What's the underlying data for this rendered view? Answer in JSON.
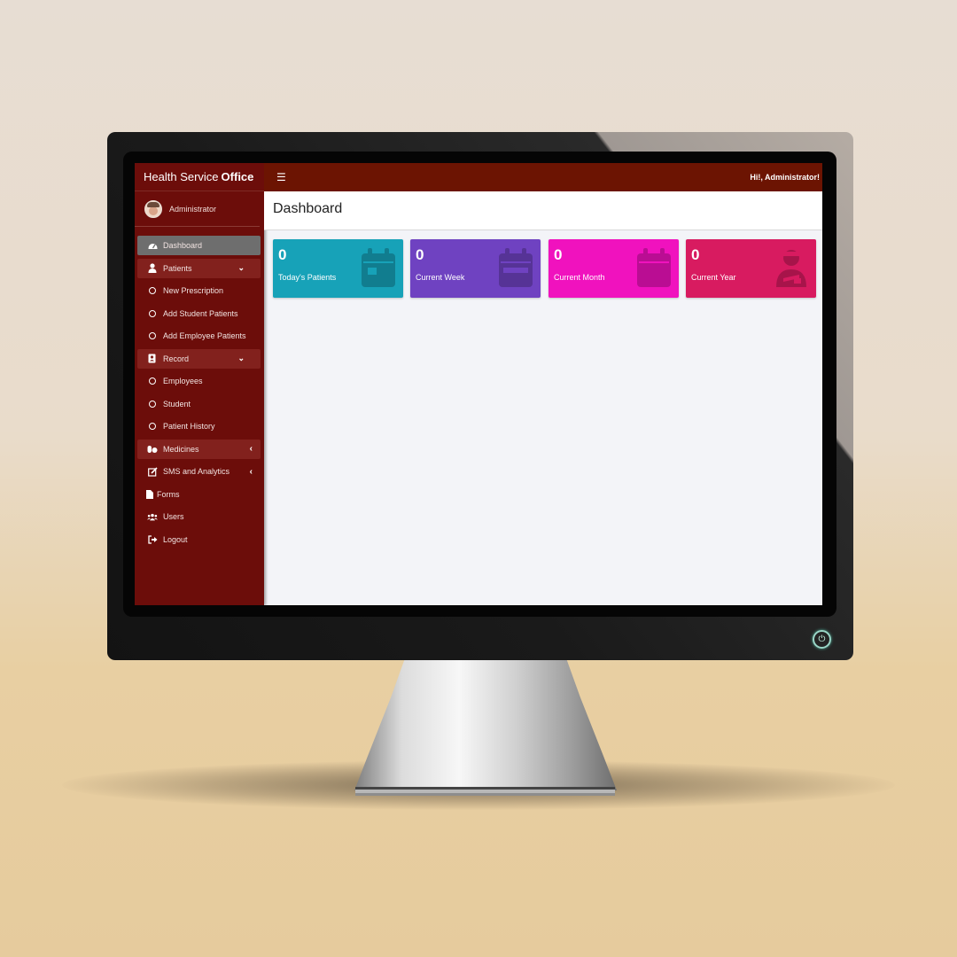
{
  "app": {
    "brand_light": "Health Service",
    "brand_bold": "Office",
    "greeting": "Hi!, Administrator!",
    "menu_icon": "hamburger-icon"
  },
  "user": {
    "name": "Administrator"
  },
  "sidebar": {
    "items": [
      {
        "label": "Dashboard",
        "icon": "dashboard-icon"
      },
      {
        "label": "Patients",
        "icon": "user-doctor-icon"
      },
      {
        "label": "New Prescription",
        "icon": "circle-icon"
      },
      {
        "label": "Add Student Patients",
        "icon": "circle-icon"
      },
      {
        "label": "Add Employee Patients",
        "icon": "circle-icon"
      },
      {
        "label": "Record",
        "icon": "address-book-icon"
      },
      {
        "label": "Employees",
        "icon": "circle-icon"
      },
      {
        "label": "Student",
        "icon": "circle-icon"
      },
      {
        "label": "Patient History",
        "icon": "circle-icon"
      },
      {
        "label": "Medicines",
        "icon": "pills-icon"
      },
      {
        "label": "SMS and Analytics",
        "icon": "edit-icon"
      },
      {
        "label": "Forms",
        "icon": "file-icon"
      },
      {
        "label": "Users",
        "icon": "users-icon"
      },
      {
        "label": "Logout",
        "icon": "sign-out-icon"
      }
    ]
  },
  "main": {
    "title": "Dashboard",
    "cards": [
      {
        "value": "0",
        "label": "Today's Patients",
        "color": "#17a2b8",
        "icon": "calendar-icon"
      },
      {
        "value": "0",
        "label": "Current Week",
        "color": "#6f42c1",
        "icon": "calendar-week-icon"
      },
      {
        "value": "0",
        "label": "Current Month",
        "color": "#f012be",
        "icon": "calendar-icon"
      },
      {
        "value": "0",
        "label": "Current Year",
        "color": "#d81b60",
        "icon": "user-injured-icon"
      }
    ]
  }
}
